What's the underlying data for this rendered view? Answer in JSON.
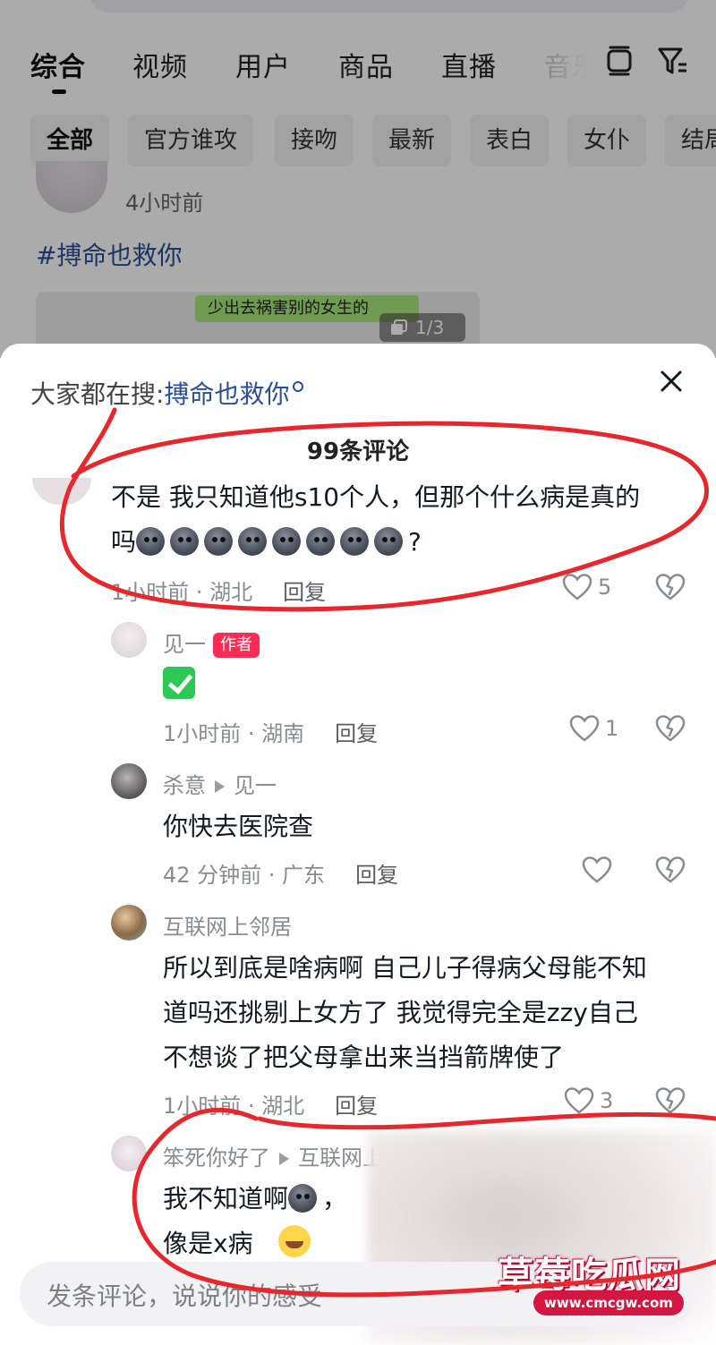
{
  "search_tabs": [
    "综合",
    "视频",
    "用户",
    "商品",
    "直播",
    "音乐"
  ],
  "filter_chips": [
    "全部",
    "官方谁攻",
    "接吻",
    "最新",
    "表白",
    "女仆",
    "结局"
  ],
  "background_post": {
    "time": "4小时前",
    "hashtag": "#搏命也救你",
    "bubble_text": "少出去祸害别的女生的",
    "image_count": "1/3"
  },
  "sheet": {
    "search_prefix": "大家都在搜:",
    "search_keyword": "搏命也救你",
    "comment_count_title": "99条评论"
  },
  "comments": [
    {
      "text_line1": "不是 我只知道他s10个人，但那个什么病是真的",
      "text_line2_prefix": "吗",
      "text_line2_suffix": "?",
      "meta": "1小时前 · 湖北",
      "reply_label": "回复",
      "likes": "5"
    },
    {
      "user": "见一",
      "badge": "作者",
      "meta": "1小时前 · 湖南",
      "reply_label": "回复",
      "likes": "1"
    },
    {
      "user": "杀意",
      "reply_to": "见一",
      "text": "你快去医院查",
      "meta": "42 分钟前 · 广东",
      "reply_label": "回复"
    },
    {
      "user": "互联网上邻居",
      "text_line1": "所以到底是啥病啊 自己儿子得病父母能不知",
      "text_line2": "道吗还挑剔上女方了 我觉得完全是zzy自己",
      "text_line3": "不想谈了把父母拿出来当挡箭牌使了",
      "meta": "1小时前 · 湖北",
      "reply_label": "回复",
      "likes": "3"
    },
    {
      "user": "笨死你好了",
      "reply_to": "互联网上邻居",
      "text_line1_prefix": "我不知道啊",
      "text_line1_suffix": "，",
      "text_line2": "像是x病"
    }
  ],
  "input_placeholder": "发条评论，说说你的感受",
  "watermark": {
    "title": "草莓吃瓜网",
    "url": "www.cmcgw.com"
  },
  "colors": {
    "accent_link": "#2a4f9a",
    "author_badge": "#fe2c55",
    "annotation_red": "#e8262c"
  }
}
